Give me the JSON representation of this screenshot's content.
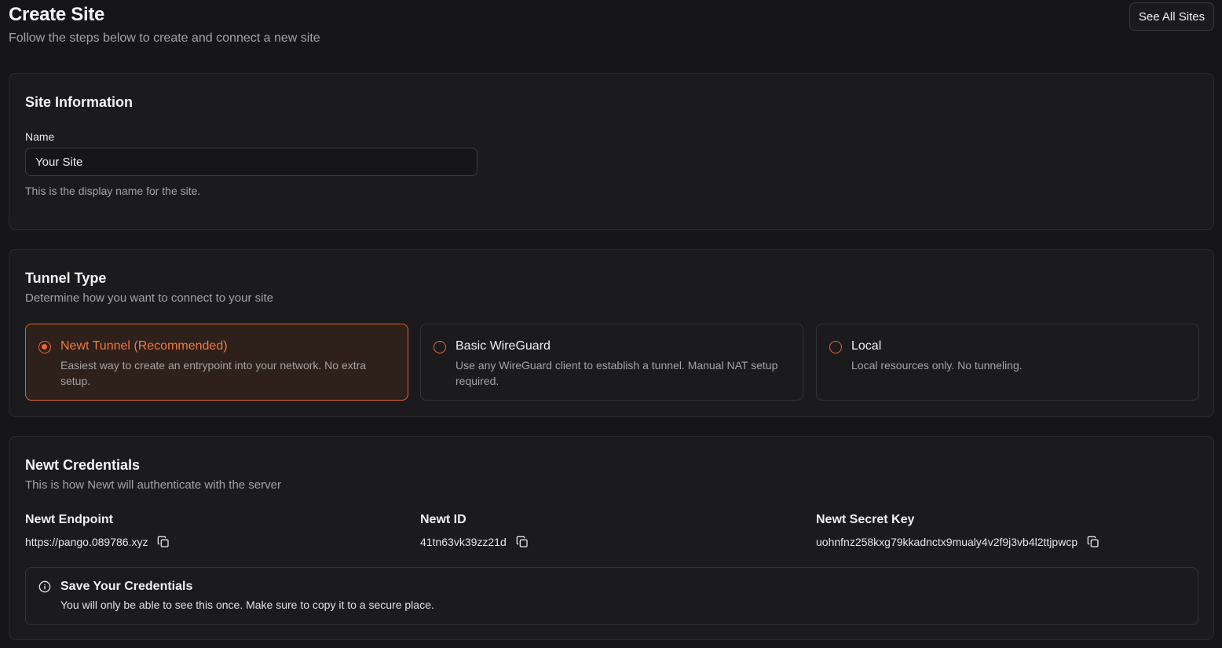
{
  "header": {
    "title": "Create Site",
    "subtitle": "Follow the steps below to create and connect a new site",
    "see_all_label": "See All Sites"
  },
  "site_info": {
    "title": "Site Information",
    "name_label": "Name",
    "name_value": "Your Site",
    "name_help": "This is the display name for the site."
  },
  "tunnel": {
    "title": "Tunnel Type",
    "description": "Determine how you want to connect to your site",
    "options": [
      {
        "title": "Newt Tunnel (Recommended)",
        "description": "Easiest way to create an entrypoint into your network. No extra setup.",
        "selected": true
      },
      {
        "title": "Basic WireGuard",
        "description": "Use any WireGuard client to establish a tunnel. Manual NAT setup required.",
        "selected": false
      },
      {
        "title": "Local",
        "description": "Local resources only. No tunneling.",
        "selected": false
      }
    ]
  },
  "credentials": {
    "title": "Newt Credentials",
    "description": "This is how Newt will authenticate with the server",
    "endpoint_label": "Newt Endpoint",
    "endpoint_value": "https://pango.089786.xyz",
    "id_label": "Newt ID",
    "id_value": "41tn63vk39zz21d",
    "secret_label": "Newt Secret Key",
    "secret_value": "uohnfnz258kxg79kkadnctx9mualy4v2f9j3vb4l2ttjpwcp",
    "alert_title": "Save Your Credentials",
    "alert_text": "You will only be able to see this once. Make sure to copy it to a secure place."
  },
  "icons": {
    "copy": "copy-icon",
    "info": "info-icon"
  },
  "colors": {
    "accent": "#e8662e",
    "background": "#161618",
    "card": "#1b1b1d"
  }
}
